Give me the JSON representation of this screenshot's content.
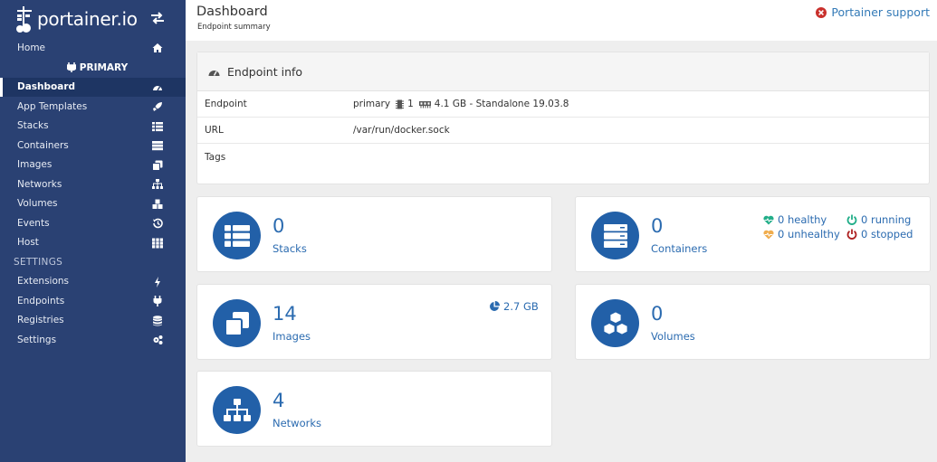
{
  "brand": {
    "name": "portainer.io"
  },
  "sidebar": {
    "home": "Home",
    "environment": "PRIMARY",
    "items": [
      {
        "label": "Dashboard",
        "icon": "dashboard-icon"
      },
      {
        "label": "App Templates",
        "icon": "rocket-icon"
      },
      {
        "label": "Stacks",
        "icon": "list-icon"
      },
      {
        "label": "Containers",
        "icon": "server-icon"
      },
      {
        "label": "Images",
        "icon": "clone-icon"
      },
      {
        "label": "Networks",
        "icon": "sitemap-icon"
      },
      {
        "label": "Volumes",
        "icon": "cubes-icon"
      },
      {
        "label": "Events",
        "icon": "history-icon"
      },
      {
        "label": "Host",
        "icon": "th-icon"
      }
    ],
    "settings_title": "SETTINGS",
    "settings_items": [
      {
        "label": "Extensions",
        "icon": "bolt-icon"
      },
      {
        "label": "Endpoints",
        "icon": "plug-icon"
      },
      {
        "label": "Registries",
        "icon": "database-icon"
      },
      {
        "label": "Settings",
        "icon": "cogs-icon"
      }
    ]
  },
  "header": {
    "title": "Dashboard",
    "subtitle": "Endpoint summary",
    "support": "Portainer support"
  },
  "endpoint_info": {
    "title": "Endpoint info",
    "rows": {
      "endpoint_label": "Endpoint",
      "endpoint_name": "primary",
      "cpu": "1",
      "memory_info": "4.1 GB - Standalone 19.03.8",
      "url_label": "URL",
      "url_value": "/var/run/docker.sock",
      "tags_label": "Tags"
    }
  },
  "tiles": {
    "stacks": {
      "count": "0",
      "label": "Stacks"
    },
    "containers": {
      "count": "0",
      "label": "Containers",
      "healthy": "0 healthy",
      "unhealthy": "0 unhealthy",
      "running": "0 running",
      "stopped": "0 stopped"
    },
    "images": {
      "count": "14",
      "label": "Images",
      "size": "2.7 GB"
    },
    "volumes": {
      "count": "0",
      "label": "Volumes"
    },
    "networks": {
      "count": "4",
      "label": "Networks"
    }
  },
  "colors": {
    "sidebar": "#2a4173",
    "accent": "#2260a8",
    "healthy": "#23ae89",
    "unhealthy": "#f0ad4e",
    "stopped": "#ae2323"
  }
}
